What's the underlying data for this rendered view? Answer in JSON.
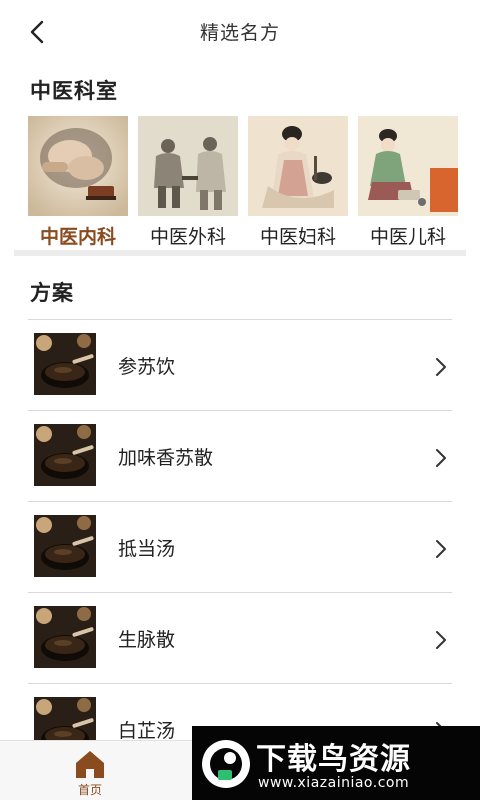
{
  "header": {
    "title": "精选名方"
  },
  "departments": {
    "title": "中医科室",
    "items": [
      {
        "label": "中医内科",
        "active": true
      },
      {
        "label": "中医外科",
        "active": false
      },
      {
        "label": "中医妇科",
        "active": false
      },
      {
        "label": "中医儿科",
        "active": false
      }
    ],
    "active_color": "#8a4b1f"
  },
  "plans": {
    "title": "方案",
    "items": [
      {
        "name": "参苏饮"
      },
      {
        "name": "加味香苏散"
      },
      {
        "name": "抵当汤"
      },
      {
        "name": "生脉散"
      },
      {
        "name": "白芷汤"
      }
    ]
  },
  "tabbar": {
    "home_label": "首页",
    "accent": "#8a4b1f"
  },
  "watermark": {
    "brand": "下载鸟资源",
    "url": "www.xiazainiao.com"
  }
}
